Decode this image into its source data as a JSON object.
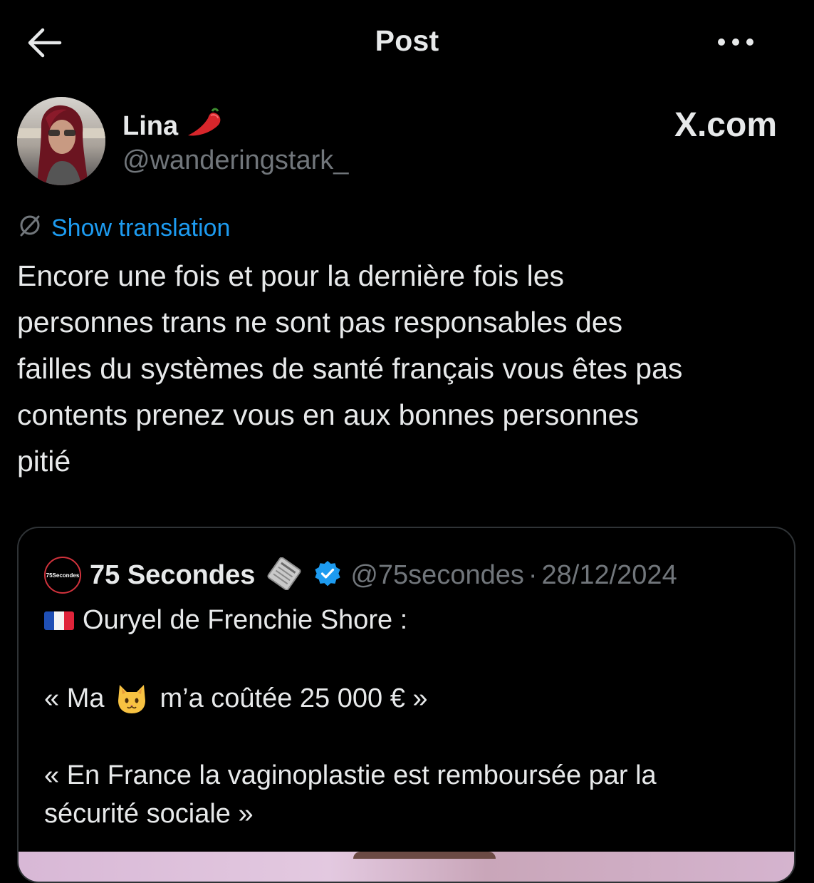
{
  "header": {
    "title": "Post"
  },
  "author": {
    "name": "Lina",
    "name_emoji": "hot-pepper-icon",
    "handle": "@wanderingstark_"
  },
  "watermark": {
    "text": "X.com"
  },
  "translation": {
    "label": "Show translation",
    "icon": "translate-icon"
  },
  "post": {
    "lines": [
      "Encore une fois et pour la dernière fois les",
      "personnes trans ne sont pas responsables des",
      "failles du systèmes de santé français vous êtes pas",
      "contents prenez vous en aux bonnes personnes",
      "pitié"
    ]
  },
  "quote": {
    "avatar_text": "75Secondes",
    "name": "75 Secondes",
    "handle": "@75secondes",
    "separator": "·",
    "date": "28/12/2024",
    "line1": "Ouryel de Frenchie Shore :",
    "line2_pre": "« Ma",
    "line2_post": "m’a coûtée 25 000 € »",
    "line3a": "« En France la vaginoplastie est remboursée par la",
    "line3b": "sécurité sociale »"
  },
  "colors": {
    "background": "#000000",
    "text": "#e7e9ea",
    "muted": "#71767b",
    "link": "#1d9bf0",
    "verified": "#1d9bf0",
    "border": "#2f3336"
  }
}
